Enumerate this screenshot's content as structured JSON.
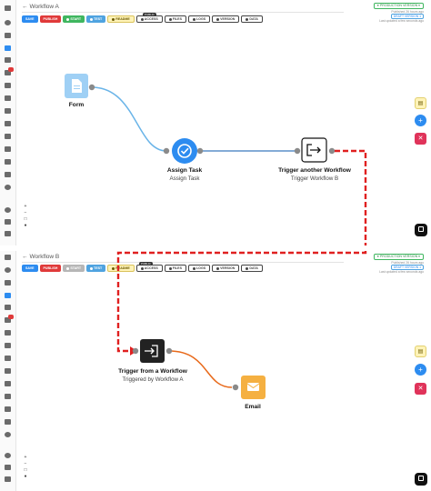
{
  "colors": {
    "save": "#2d8cf0",
    "publish": "#e03a3a",
    "start": "#3fb65f",
    "test": "#4fa3e0",
    "connector_red": "#e02020",
    "edge_blue": "#6ab4e8",
    "edge_orange": "#e8691a",
    "form_node": "#9fd0f5",
    "assign_node": "#2d8cf0",
    "email_node": "#f5b041"
  },
  "workflow_a": {
    "title": "Workflow A",
    "back_icon": "arrow-left-icon",
    "toolbar": {
      "save": "SAVE",
      "publish": "PUBLISH",
      "start": "START",
      "test": "TEST",
      "readme": "README",
      "access": "ACCESS",
      "access_badge": "PUBLIC",
      "files": "FILES",
      "logs": "LOGS",
      "version": "VERSION",
      "data": "DATA"
    },
    "production": "PRODUCTION VERSION",
    "published": "Published 26 hours ago",
    "draft_version": "DRAFT VERSION 1",
    "last_updated": "Last updated a few seconds ago",
    "nodes": {
      "form": {
        "label": "Form",
        "icon": "document-icon"
      },
      "assign": {
        "label": "Assign Task",
        "sublabel": "Assign Task",
        "icon": "check-circle-icon"
      },
      "trigger_another": {
        "label": "Trigger another Workflow",
        "sublabel": "Trigger Workflow B",
        "icon": "sign-out-icon"
      }
    },
    "zoom": {
      "in": "+",
      "out": "−",
      "fit": "□",
      "lock": "●"
    }
  },
  "workflow_b": {
    "title": "Workflow B",
    "back_icon": "arrow-left-icon",
    "toolbar": {
      "save": "SAVE",
      "publish": "PUBLISH",
      "start": "START",
      "test": "TEST",
      "readme": "README",
      "access": "ACCESS",
      "access_badge": "PUBLIC",
      "files": "FILES",
      "logs": "LOGS",
      "version": "VERSION",
      "data": "DATA"
    },
    "production": "PRODUCTION VERSION",
    "published": "Published 26 hours ago",
    "draft_version": "DRAFT VERSION 1",
    "last_updated": "Last updated a few seconds ago",
    "nodes": {
      "trigger_from": {
        "label": "Trigger from a Workflow",
        "sublabel": "Triggered by Workflow A",
        "icon": "sign-in-icon"
      },
      "email": {
        "label": "Email",
        "icon": "envelope-icon"
      }
    },
    "zoom": {
      "in": "+",
      "out": "−",
      "fit": "□",
      "lock": "●"
    }
  },
  "right_tools": {
    "note_icon": "sticky-note-icon",
    "add_icon": "plus-icon",
    "tools_icon": "tools-icon",
    "chat_icon": "chat-icon"
  },
  "sidebar_icons": [
    "home-icon",
    "dashboard-icon",
    "copy-icon",
    "folder-icon",
    "users-icon",
    "key-icon",
    "people-icon",
    "calendar-icon",
    "lock-icon",
    "briefcase-icon",
    "table-icon",
    "trophy-icon",
    "history-icon",
    "pie-chart-icon",
    "help-icon",
    "flag-icon",
    "settings-icon",
    "bookmark-icon"
  ]
}
